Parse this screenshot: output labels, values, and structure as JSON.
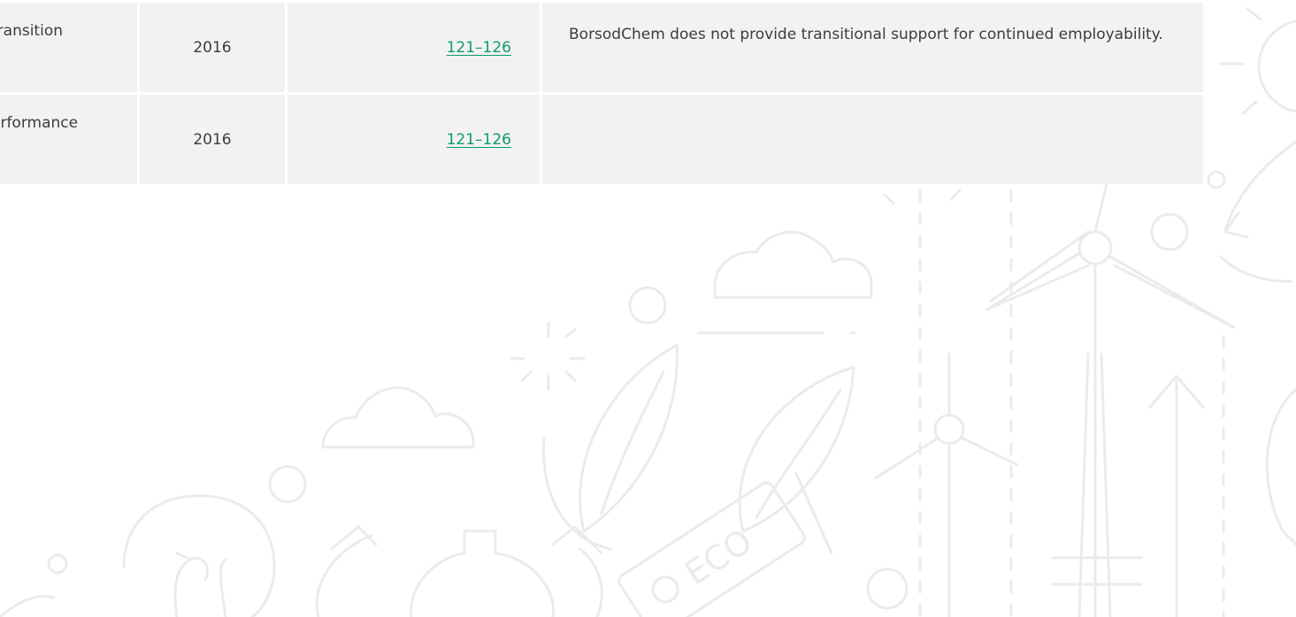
{
  "table": {
    "rows": [
      {
        "topic": "transition",
        "year": "2016",
        "pages": "121–126",
        "note": "BorsodChem does not provide transitional support for continued employability."
      },
      {
        "topic": "erformance",
        "year": "2016",
        "pages": "121–126",
        "note": ""
      }
    ]
  },
  "background": {
    "eco_label": "ECO",
    "icons": [
      "sun-icon",
      "cloud-icon",
      "wind-turbine-icon",
      "leaf-icon",
      "gear-icon",
      "lightbulb-icon",
      "eco-tag-icon",
      "recycle-icon",
      "power-pylon-icon",
      "arrow-up-icon"
    ],
    "line_color": "#ebebeb"
  },
  "colors": {
    "row_background": "#f2f2f2",
    "link": "#0e9a6c",
    "text": "#3c3c3c"
  }
}
